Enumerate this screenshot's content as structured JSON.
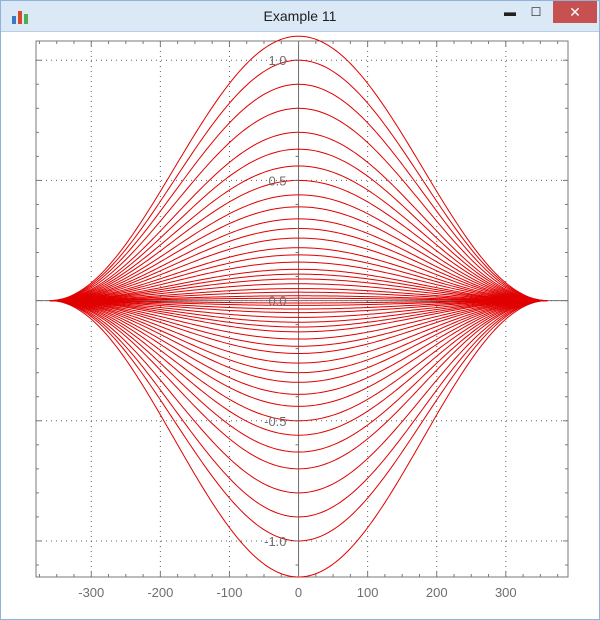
{
  "window": {
    "title": "Example 11",
    "controls": {
      "minimize": "▬",
      "maximize": "☐",
      "close": "✕"
    },
    "app_icon": "bar-chart-icon"
  },
  "colors": {
    "curve": "#e00000",
    "axis": "#707070",
    "grid": "#606060",
    "frame": "#7a7a7a",
    "title_bar": "#dbe8f6",
    "close_button": "#c75050"
  },
  "chart_data": {
    "type": "line",
    "title": "",
    "xlabel": "",
    "ylabel": "",
    "xlim": [
      -380,
      390
    ],
    "ylim": [
      -1.15,
      1.08
    ],
    "grid": true,
    "legend": "none",
    "x_ticks": [
      -300,
      -200,
      -100,
      0,
      100,
      200,
      300
    ],
    "x_tick_labels": [
      "-300",
      "-200",
      "-100",
      "0",
      "100",
      "200",
      "300"
    ],
    "y_ticks": [
      1.0,
      0.5,
      0.0,
      -0.5,
      -1.0
    ],
    "y_tick_labels": [
      "1.0",
      "0.5",
      "0.0",
      "-0.5",
      "-1.0"
    ],
    "curve_family": {
      "description": "bell curves y = a·(1+cos(π·x/360))/2 for x in [-360, 360]",
      "x_range": [
        -360,
        360
      ],
      "amplitudes": [
        1.1,
        1.0,
        0.9,
        0.8,
        0.7,
        0.63,
        0.56,
        0.5,
        0.44,
        0.39,
        0.34,
        0.3,
        0.26,
        0.22,
        0.19,
        0.16,
        0.13,
        0.11,
        0.09,
        0.07,
        0.05,
        0.035,
        0.02,
        0.01,
        -0.01,
        -0.02,
        -0.035,
        -0.05,
        -0.07,
        -0.09,
        -0.11,
        -0.13,
        -0.16,
        -0.19,
        -0.22,
        -0.26,
        -0.3,
        -0.34,
        -0.39,
        -0.44,
        -0.5,
        -0.56,
        -0.63,
        -0.7,
        -0.8,
        -0.9,
        -1.0,
        -1.15
      ]
    }
  }
}
